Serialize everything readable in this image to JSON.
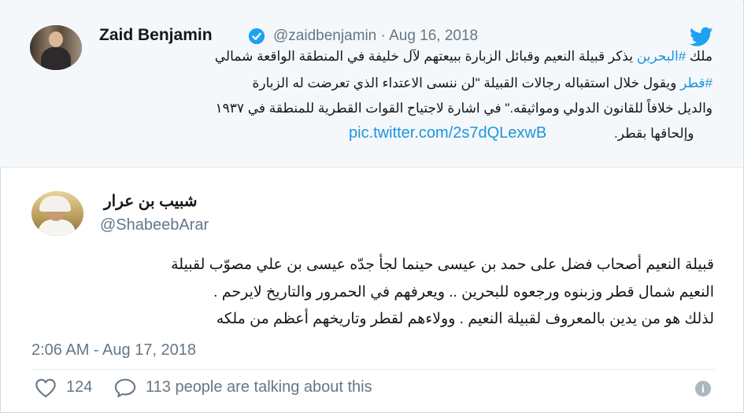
{
  "quoted_tweet": {
    "author_name": "Zaid Benjamin",
    "handle_date": "@zaidbenjamin · Aug 16, 2018",
    "line1_pre": "ملك ",
    "line1_hashtag": "#البحرين",
    "line1_post": " يذكر قبيلة النعيم وقبائل الزبارة ببيعتهم لآل خليفة في المنطقة الواقعة شمالي",
    "line2_hashtag": "#قطر",
    "line2_post": " ويقول خلال استقباله رجالات القبيلة \"لن ننسى الاعتداء الذي تعرضت له الزبارة",
    "line3": "والديل خلافاً للقانون الدولي ومواثيقه.\" في اشارة لاجتياح القوات القطرية للمنطقة في ١٩٣٧",
    "line4": "وإلحاقها بقطر.",
    "link": "pic.twitter.com/2s7dQLexwB",
    "avatar_icon": "zaid-avatar",
    "verified_icon": "verified-badge-icon",
    "brand_icon": "twitter-bird-icon",
    "accent_color": "#1b95e0"
  },
  "tweet": {
    "author_name": "شبيب بن عرار",
    "handle": "@ShabeebArar",
    "lines": [
      "قبيلة النعيم أصحاب فضل على حمد بن عيسى حينما لجأ جدّه عيسى بن علي مصوّب لقبيلة",
      "النعيم شمال قطر وزبنوه ورجعوه للبحرين  .. ويعرفهم في الحمرور  والتاريخ لايرحم .",
      "لذلك هو من يدين بالمعروف لقبيلة النعيم . وولاءهم لقطر وتاريخهم أعظم من ملكه"
    ],
    "timestamp": "2:06 AM - Aug 17, 2018",
    "likes": "124",
    "talking": "113 people are talking about this",
    "icons": {
      "like": "heart-icon",
      "reply": "speech-bubble-icon",
      "info": "info-icon"
    }
  }
}
